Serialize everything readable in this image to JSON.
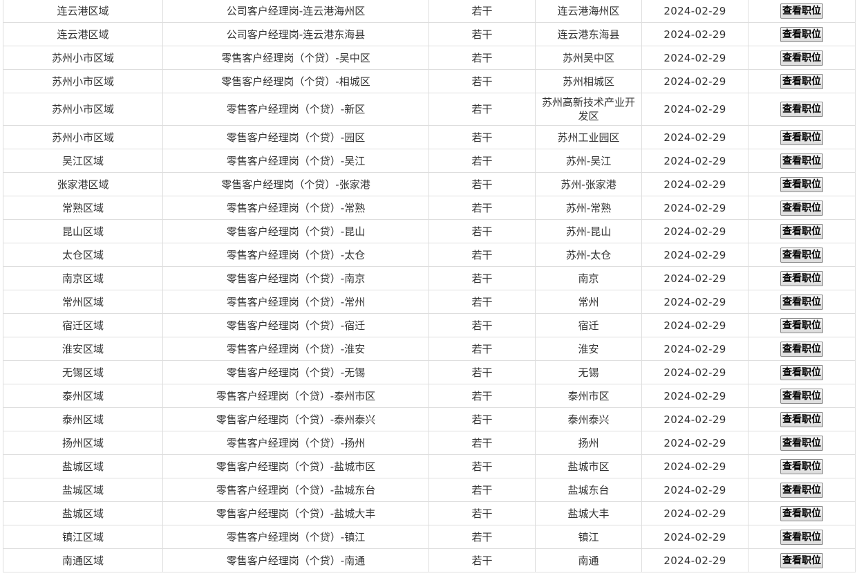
{
  "button_label": "查看职位",
  "rows": [
    {
      "region": "连云港区域",
      "position": "公司客户经理岗-连云港海州区",
      "count": "若干",
      "location": "连云港海州区",
      "date": "2024-02-29"
    },
    {
      "region": "连云港区域",
      "position": "公司客户经理岗-连云港东海县",
      "count": "若干",
      "location": "连云港东海县",
      "date": "2024-02-29"
    },
    {
      "region": "苏州小市区域",
      "position": "零售客户经理岗（个贷）-吴中区",
      "count": "若干",
      "location": "苏州吴中区",
      "date": "2024-02-29"
    },
    {
      "region": "苏州小市区域",
      "position": "零售客户经理岗（个贷）-相城区",
      "count": "若干",
      "location": "苏州相城区",
      "date": "2024-02-29"
    },
    {
      "region": "苏州小市区域",
      "position": "零售客户经理岗（个贷）-新区",
      "count": "若干",
      "location": "苏州高新技术产业开发区",
      "date": "2024-02-29",
      "tall": true
    },
    {
      "region": "苏州小市区域",
      "position": "零售客户经理岗（个贷）-园区",
      "count": "若干",
      "location": "苏州工业园区",
      "date": "2024-02-29"
    },
    {
      "region": "吴江区域",
      "position": "零售客户经理岗（个贷）-吴江",
      "count": "若干",
      "location": "苏州-吴江",
      "date": "2024-02-29"
    },
    {
      "region": "张家港区域",
      "position": "零售客户经理岗（个贷）-张家港",
      "count": "若干",
      "location": "苏州-张家港",
      "date": "2024-02-29"
    },
    {
      "region": "常熟区域",
      "position": "零售客户经理岗（个贷）-常熟",
      "count": "若干",
      "location": "苏州-常熟",
      "date": "2024-02-29"
    },
    {
      "region": "昆山区域",
      "position": "零售客户经理岗（个贷）-昆山",
      "count": "若干",
      "location": "苏州-昆山",
      "date": "2024-02-29"
    },
    {
      "region": "太仓区域",
      "position": "零售客户经理岗（个贷）-太仓",
      "count": "若干",
      "location": "苏州-太仓",
      "date": "2024-02-29"
    },
    {
      "region": "南京区域",
      "position": "零售客户经理岗（个贷）-南京",
      "count": "若干",
      "location": "南京",
      "date": "2024-02-29"
    },
    {
      "region": "常州区域",
      "position": "零售客户经理岗（个贷）-常州",
      "count": "若干",
      "location": "常州",
      "date": "2024-02-29"
    },
    {
      "region": "宿迁区域",
      "position": "零售客户经理岗（个贷）-宿迁",
      "count": "若干",
      "location": "宿迁",
      "date": "2024-02-29"
    },
    {
      "region": "淮安区域",
      "position": "零售客户经理岗（个贷）-淮安",
      "count": "若干",
      "location": "淮安",
      "date": "2024-02-29"
    },
    {
      "region": "无锡区域",
      "position": "零售客户经理岗（个贷）-无锡",
      "count": "若干",
      "location": "无锡",
      "date": "2024-02-29"
    },
    {
      "region": "泰州区域",
      "position": "零售客户经理岗（个贷）-泰州市区",
      "count": "若干",
      "location": "泰州市区",
      "date": "2024-02-29"
    },
    {
      "region": "泰州区域",
      "position": "零售客户经理岗（个贷）-泰州泰兴",
      "count": "若干",
      "location": "泰州泰兴",
      "date": "2024-02-29"
    },
    {
      "region": "扬州区域",
      "position": "零售客户经理岗（个贷）-扬州",
      "count": "若干",
      "location": "扬州",
      "date": "2024-02-29"
    },
    {
      "region": "盐城区域",
      "position": "零售客户经理岗（个贷）-盐城市区",
      "count": "若干",
      "location": "盐城市区",
      "date": "2024-02-29"
    },
    {
      "region": "盐城区域",
      "position": "零售客户经理岗（个贷）-盐城东台",
      "count": "若干",
      "location": "盐城东台",
      "date": "2024-02-29"
    },
    {
      "region": "盐城区域",
      "position": "零售客户经理岗（个贷）-盐城大丰",
      "count": "若干",
      "location": "盐城大丰",
      "date": "2024-02-29"
    },
    {
      "region": "镇江区域",
      "position": "零售客户经理岗（个贷）-镇江",
      "count": "若干",
      "location": "镇江",
      "date": "2024-02-29"
    },
    {
      "region": "南通区域",
      "position": "零售客户经理岗（个贷）-南通",
      "count": "若干",
      "location": "南通",
      "date": "2024-02-29"
    }
  ]
}
